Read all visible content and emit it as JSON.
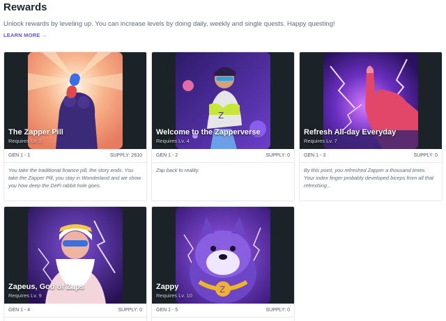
{
  "header": {
    "title": "Rewards",
    "subtitle": "Unlock rewards by leveling up. You can increase levels by doing daily, weekly and single quests. Happy questing!",
    "learn_more": "LEARN MORE",
    "learn_more_arrow": "→"
  },
  "cards": [
    {
      "name": "The Zapper Pill",
      "requires": "Requires Lv. 2",
      "gen": "GEN 1 - 1",
      "supply": "SUPPLY: 2610",
      "description": "You take the traditional finance pill, the story ends. You take the Zapper Pill, you stay in Wonderland and we show you how deep the DeFi rabbit hole goes."
    },
    {
      "name": "Welcome to the Zapperverse",
      "requires": "Requires Lv. 4",
      "gen": "GEN 1 - 2",
      "supply": "SUPPLY: 0",
      "description": "Zap back to reality."
    },
    {
      "name": "Refresh All-day Everyday",
      "requires": "Requires Lv. 7",
      "gen": "GEN 1 - 3",
      "supply": "SUPPLY: 0",
      "description": "By this point, you refreshed Zapper a thousand times. Your index finger probably developed biceps from all that refreshing..."
    },
    {
      "name": "Zapeus, God of Zaps",
      "requires": "Requires Lv. 9",
      "gen": "GEN 1 - 4",
      "supply": "SUPPLY: 0"
    },
    {
      "name": "Zappy",
      "requires": "Requires Lv. 10",
      "gen": "GEN 1 - 5",
      "supply": "SUPPLY: 0"
    }
  ],
  "colors": {
    "accent": "#6a4df3",
    "banner_bg": "#1b2228"
  }
}
